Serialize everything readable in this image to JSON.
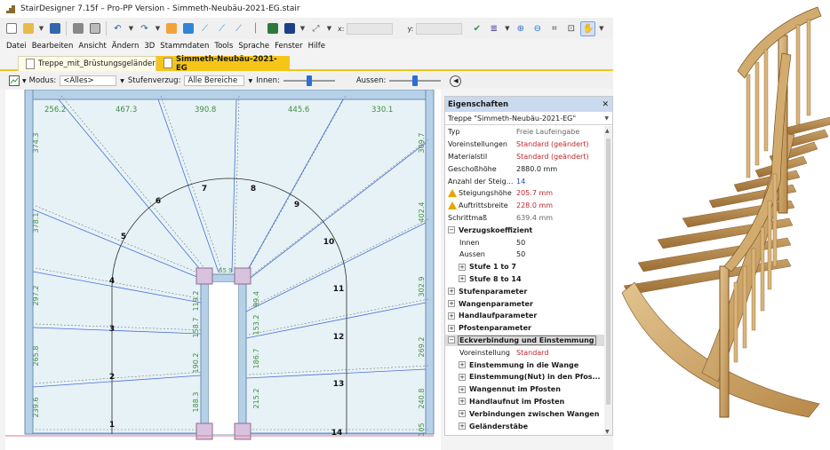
{
  "window": {
    "title": "StairDesigner 7.15f – Pro-PP Version - Simmeth-Neubäu-2021-EG.stair"
  },
  "toolbar": {
    "coord_x_label": "x:",
    "coord_y_label": "y:"
  },
  "menu": [
    "Datei",
    "Bearbeiten",
    "Ansicht",
    "Ändern",
    "3D",
    "Stammdaten",
    "Tools",
    "Sprache",
    "Fenster",
    "Hilfe"
  ],
  "tabs": [
    "Treppe_mit_Brüstungsgeländer",
    "Simmeth-Neubäu-2021-EG"
  ],
  "filter_bar": {
    "modus_label": "Modus:",
    "modus_value": "<Alles>",
    "stufenverzug_label": "Stufenverzug:",
    "stufenverzug_value": "Alle Bereiche",
    "innen_label": "Innen:",
    "aussen_label": "Aussen:"
  },
  "plan": {
    "top_dims": [
      "256.2",
      "467.3",
      "390.8",
      "445.6",
      "330.1"
    ],
    "left_dims": [
      "374.3",
      "378.1",
      "297.2",
      "265.8",
      "239.6"
    ],
    "right_dims": [
      "309.7",
      "402.4",
      "302.9",
      "269.2",
      "240.8",
      "105"
    ],
    "inner_left_dims": [
      "119.2",
      "158.7",
      "190.2",
      "188.3"
    ],
    "inner_right_dims": [
      "99.4",
      "153.2",
      "186.7",
      "215.2"
    ],
    "core_dim": "65.9",
    "step_numbers": [
      "1",
      "2",
      "3",
      "4",
      "5",
      "6",
      "7",
      "8",
      "9",
      "10",
      "11",
      "12",
      "13",
      "14"
    ]
  },
  "properties": {
    "header": "Eigenschaften",
    "selection": "Treppe \"Simmeth-Neubäu-2021-EG\"",
    "rows": [
      {
        "key": "Typ",
        "value": "Freie Laufeingabe",
        "style": "gray"
      },
      {
        "key": "Voreinstellungen",
        "value": "Standard (geändert)",
        "style": "red"
      },
      {
        "key": "Materialstil",
        "value": "Standard (geändert)",
        "style": "red"
      },
      {
        "key": "Geschoßhöhe",
        "value": "2880.0 mm",
        "style": ""
      },
      {
        "key": "Anzahl der Steig...",
        "value": "14",
        "style": "blue"
      },
      {
        "key": "Steigungshöhe",
        "value": "205.7 mm",
        "style": "red",
        "warn": true
      },
      {
        "key": "Auftrittsbreite",
        "value": "228.0 mm",
        "style": "red",
        "warn": true
      },
      {
        "key": "Schrittmaß",
        "value": "639.4 mm",
        "style": "gray"
      }
    ],
    "verzug": {
      "group": "Verzugskoeffizient",
      "innen_label": "Innen",
      "innen_value": "50",
      "aussen_label": "Aussen",
      "aussen_value": "50",
      "sub1": "Stufe 1 to 7",
      "sub2": "Stufe 8 to 14"
    },
    "groups": [
      "Stufenparameter",
      "Wangenparameter",
      "Handlaufparameter",
      "Pfostenparameter"
    ],
    "eck": {
      "group": "Eckverbindung und Einstemmung",
      "voreinstellung_label": "Voreinstellung",
      "voreinstellung_value": "Standard",
      "subs": [
        "Einstemmung in die Wange",
        "Einstemmung(Nut) in den Pfos...",
        "Wangennut im Pfosten",
        "Handlaufnut im Pfosten",
        "Verbindungen zwischen Wangen",
        "Geländerstäbe"
      ]
    }
  },
  "colors": {
    "accent_tab": "#f5c518",
    "panel_header": "#c9d9ee",
    "plan_fill": "#e6f2f6",
    "stringer": "#b6d0e8",
    "post": "#d9c2de",
    "walk_line_blue": "#4c6ed8",
    "dim_green": "#3f8f3f",
    "wood": "#c9a46a"
  }
}
